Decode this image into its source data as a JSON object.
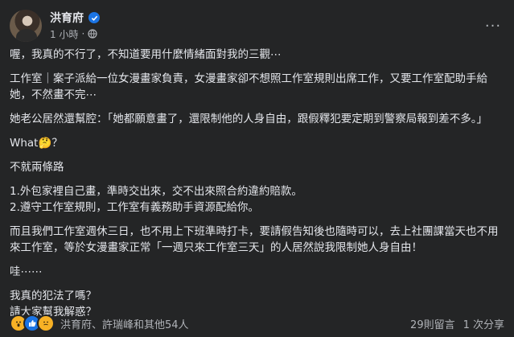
{
  "post": {
    "author": "洪育府",
    "time": "1 小時",
    "separator": "·",
    "more_label": "···"
  },
  "content": {
    "p1": "喔，我真的不行了，不知道要用什麼情緒面對我的三觀⋯",
    "p2": "工作室｜案子派給一位女漫畫家負責，女漫畫家卻不想照工作室規則出席工作，又要工作室配助手給她，不然畫不完⋯",
    "p3": "她老公居然還幫腔：「她都願意畫了，還限制他的人身自由，跟假釋犯要定期到警察局報到差不多。」",
    "p4": "What🤔？",
    "p5": "不就兩條路",
    "p6a": "1.外包家裡自己畫，準時交出來，交不出來照合約違約賠款。",
    "p6b": "2.遵守工作室規則，工作室有義務助手資源配給你。",
    "p7": "而且我們工作室週休三日，也不用上下班準時打卡，要請假告知後也隨時可以，去上社團課當天也不用來工作室，等於女漫畫家正常「一週只來工作室三天」的人居然說我限制她人身自由！",
    "p8": "哇⋯⋯",
    "p9a": "我真的犯法了嗎？",
    "p9b": "請大家幫我解惑？"
  },
  "footer": {
    "reaction_names": "洪育府、許瑞峰和其他54人",
    "comments": "29則留言",
    "shares": "1 次分享"
  },
  "colors": {
    "background": "#242526",
    "text": "#e4e6eb",
    "secondary": "#b0b3b8",
    "accent": "#1b74e4"
  },
  "icons": [
    "verified-icon",
    "globe-icon",
    "more-icon",
    "wow-reaction-icon",
    "like-reaction-icon",
    "care-reaction-icon"
  ]
}
